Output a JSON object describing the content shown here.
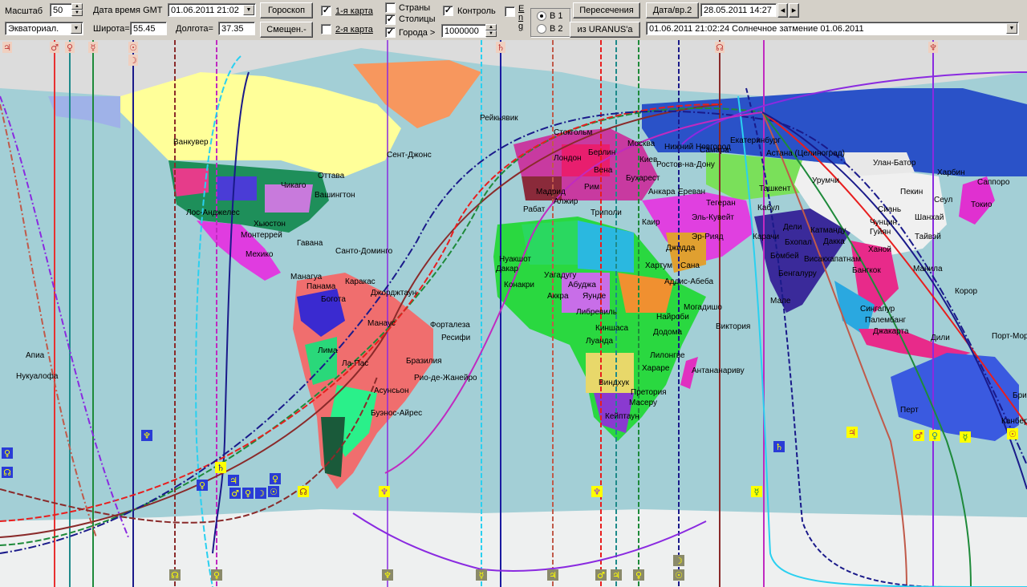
{
  "toolbar": {
    "scale_label": "Масштаб",
    "scale_value": "50",
    "datetime_label": "Дата время GMT",
    "datetime_value": "01.06.2011 21:02",
    "horoscope_btn": "Гороскоп",
    "chart1_label": "1-я карта",
    "chart1_checked": true,
    "chart2_label": "2-я карта",
    "chart2_checked": false,
    "countries_label": "Страны",
    "countries_checked": false,
    "capitals_label": "Столицы",
    "capitals_checked": true,
    "cities_label": "Города >",
    "cities_checked": true,
    "cities_value": "1000000",
    "control_label": "Контроль",
    "control_checked": true,
    "eng_label": "E n g",
    "eng_checked": false,
    "b1_label": "В 1",
    "b2_label": "В 2",
    "intersections_btn": "Пересечения",
    "from_uranus_btn": "из URANUS'а",
    "date2_btn": "Дата/вр.2",
    "date2_value": "28.05.2011 14:27",
    "projection_value": "Экваториал.",
    "lat_label": "Широта=",
    "lat_value": "55.45",
    "lon_label": "Долгота=",
    "lon_value": "37.35",
    "shift_btn": "Смещен.-",
    "event_value": "01.06.2011 21:02:24 Солнечное затмение 01.06.2011"
  },
  "colors": {
    "ocean": "#a3cfd6",
    "land_north_ice": "#e0e0e0",
    "ice_south": "#e8eaea",
    "marker_bg_yellow": "#ffff00",
    "marker_bg_blue": "#2a3cd6",
    "marker_bg_gray": "#8a8a6a"
  },
  "cities": [
    {
      "name": "Рейкьявик"
    },
    {
      "name": "Стокгольм"
    },
    {
      "name": "Москва"
    },
    {
      "name": "Нижний Новгород"
    },
    {
      "name": "Самара"
    },
    {
      "name": "Екатеринбург"
    },
    {
      "name": "Берлин"
    },
    {
      "name": "Лондон"
    },
    {
      "name": "Киев"
    },
    {
      "name": "Вена"
    },
    {
      "name": "Ростов-на-Дону"
    },
    {
      "name": "Астана (Целиноград)"
    },
    {
      "name": "Бухарест"
    },
    {
      "name": "Мадрид"
    },
    {
      "name": "Рим"
    },
    {
      "name": "Анкара"
    },
    {
      "name": "Ереван"
    },
    {
      "name": "Ташкент"
    },
    {
      "name": "Улан-Батор"
    },
    {
      "name": "Харбин"
    },
    {
      "name": "Урумчи"
    },
    {
      "name": "Пекин"
    },
    {
      "name": "Сеул"
    },
    {
      "name": "Саппоро"
    },
    {
      "name": "Токио"
    },
    {
      "name": "Сиань"
    },
    {
      "name": "Шанхай"
    },
    {
      "name": "Чунцин"
    },
    {
      "name": "Гуйян"
    },
    {
      "name": "Тайвэй"
    },
    {
      "name": "Ханой"
    },
    {
      "name": "Манила"
    },
    {
      "name": "Бангкок"
    },
    {
      "name": "Сингапур"
    },
    {
      "name": "Палембанг"
    },
    {
      "name": "Джакарта"
    },
    {
      "name": "Дили"
    },
    {
      "name": "Порт-Морсби"
    },
    {
      "name": "Корор"
    },
    {
      "name": "Пекин"
    },
    {
      "name": "Рабат"
    },
    {
      "name": "Алжир"
    },
    {
      "name": "Триполи"
    },
    {
      "name": "Каир"
    },
    {
      "name": "Тегеран"
    },
    {
      "name": "Кабул"
    },
    {
      "name": "Эль-Кувейт"
    },
    {
      "name": "Эр-Рияд"
    },
    {
      "name": "Джидда"
    },
    {
      "name": "Карачи"
    },
    {
      "name": "Дели"
    },
    {
      "name": "Катманду"
    },
    {
      "name": "Бхопал"
    },
    {
      "name": "Дакка"
    },
    {
      "name": "Бомбей"
    },
    {
      "name": "Бенгалуру"
    },
    {
      "name": "Висакхапатнам"
    },
    {
      "name": "Мале"
    },
    {
      "name": "Хартум"
    },
    {
      "name": "Сана"
    },
    {
      "name": "Аддис-Абеба"
    },
    {
      "name": "Могадишо"
    },
    {
      "name": "Найроби"
    },
    {
      "name": "Додома"
    },
    {
      "name": "Виктория"
    },
    {
      "name": "Лилонгве"
    },
    {
      "name": "Хараре"
    },
    {
      "name": "Антананариву"
    },
    {
      "name": "Претория"
    },
    {
      "name": "Масеру"
    },
    {
      "name": "Кейптаун"
    },
    {
      "name": "Виндхук"
    },
    {
      "name": "Луанда"
    },
    {
      "name": "Киншаса"
    },
    {
      "name": "Либревиль"
    },
    {
      "name": "Яунде"
    },
    {
      "name": "Абуджа"
    },
    {
      "name": "Аккра"
    },
    {
      "name": "Уагадугу"
    },
    {
      "name": "Конакри"
    },
    {
      "name": "Дакар"
    },
    {
      "name": "Нуакшот"
    },
    {
      "name": "Ванкувер"
    },
    {
      "name": "Оттава"
    },
    {
      "name": "Чикаго"
    },
    {
      "name": "Вашингтон"
    },
    {
      "name": "Лос-Анджелес"
    },
    {
      "name": "Хьюстон"
    },
    {
      "name": "Монтеррей"
    },
    {
      "name": "Мехико"
    },
    {
      "name": "Гавана"
    },
    {
      "name": "Санто-Доминго"
    },
    {
      "name": "Манагуа"
    },
    {
      "name": "Панама"
    },
    {
      "name": "Каракас"
    },
    {
      "name": "Богота"
    },
    {
      "name": "Джорджтаун"
    },
    {
      "name": "Сент-Джонс"
    },
    {
      "name": "Манаус"
    },
    {
      "name": "Форталеза"
    },
    {
      "name": "Ресифи"
    },
    {
      "name": "Лима"
    },
    {
      "name": "Бразилия"
    },
    {
      "name": "Ла-Пас"
    },
    {
      "name": "Рио-де-Жанейро"
    },
    {
      "name": "Асунсьон"
    },
    {
      "name": "Буэнос-Айрес"
    },
    {
      "name": "Апиа"
    },
    {
      "name": "Нукуалофа"
    },
    {
      "name": "Перт"
    },
    {
      "name": "Канберра"
    },
    {
      "name": "Брис"
    }
  ],
  "markers": {
    "top": [
      "♃",
      "♂",
      "♀",
      "☿",
      "☉",
      "☽",
      "♄",
      "☊",
      "♆"
    ],
    "bottom": [
      "☊",
      "♀",
      "♆",
      "☿",
      "♃",
      "♂",
      "♃",
      "♀",
      "☽",
      "☉"
    ]
  }
}
